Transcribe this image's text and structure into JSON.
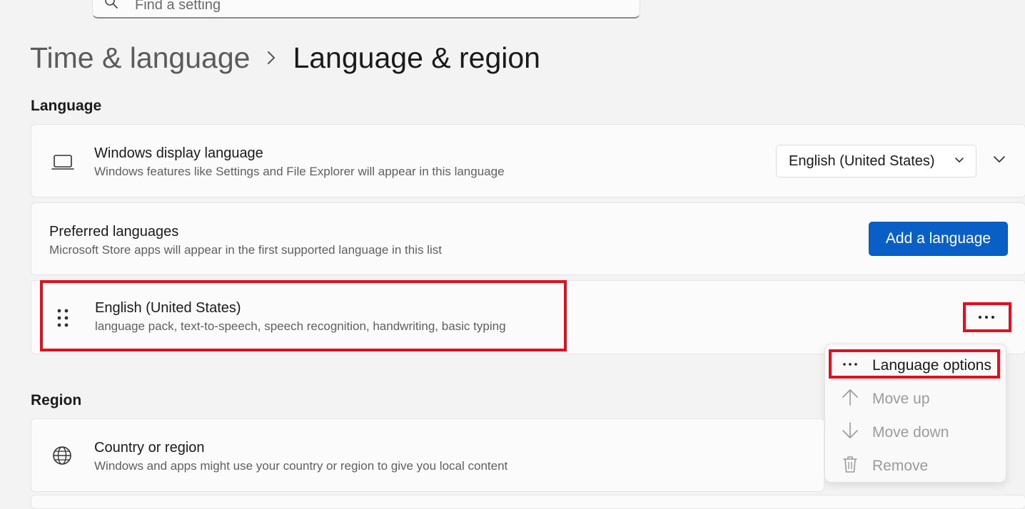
{
  "search": {
    "placeholder": "Find a setting"
  },
  "breadcrumb": {
    "parent": "Time & language",
    "current": "Language & region"
  },
  "sections": {
    "language": "Language",
    "region": "Region"
  },
  "display_language": {
    "title": "Windows display language",
    "description": "Windows features like Settings and File Explorer will appear in this language",
    "selected": "English (United States)",
    "icon": "laptop-icon"
  },
  "preferred_languages": {
    "title": "Preferred languages",
    "description": "Microsoft Store apps will appear in the first supported language in this list",
    "add_button": "Add a language"
  },
  "language_item": {
    "name": "English (United States)",
    "features": "language pack, text-to-speech, speech recognition, handwriting, basic typing",
    "icon": "drag-handle-icon"
  },
  "context_menu": {
    "items": [
      {
        "label": "Language options",
        "icon": "more-icon",
        "enabled": true
      },
      {
        "label": "Move up",
        "icon": "arrow-up-icon",
        "enabled": false
      },
      {
        "label": "Move down",
        "icon": "arrow-down-icon",
        "enabled": false
      },
      {
        "label": "Remove",
        "icon": "trash-icon",
        "enabled": false
      }
    ]
  },
  "country_region": {
    "title": "Country or region",
    "description": "Windows and apps might use your country or region to give you local content",
    "icon": "globe-icon"
  },
  "colors": {
    "accent": "#0a5fc7",
    "highlight": "#e0101f",
    "background": "#f3f3f3",
    "card": "#fbfbfb"
  }
}
